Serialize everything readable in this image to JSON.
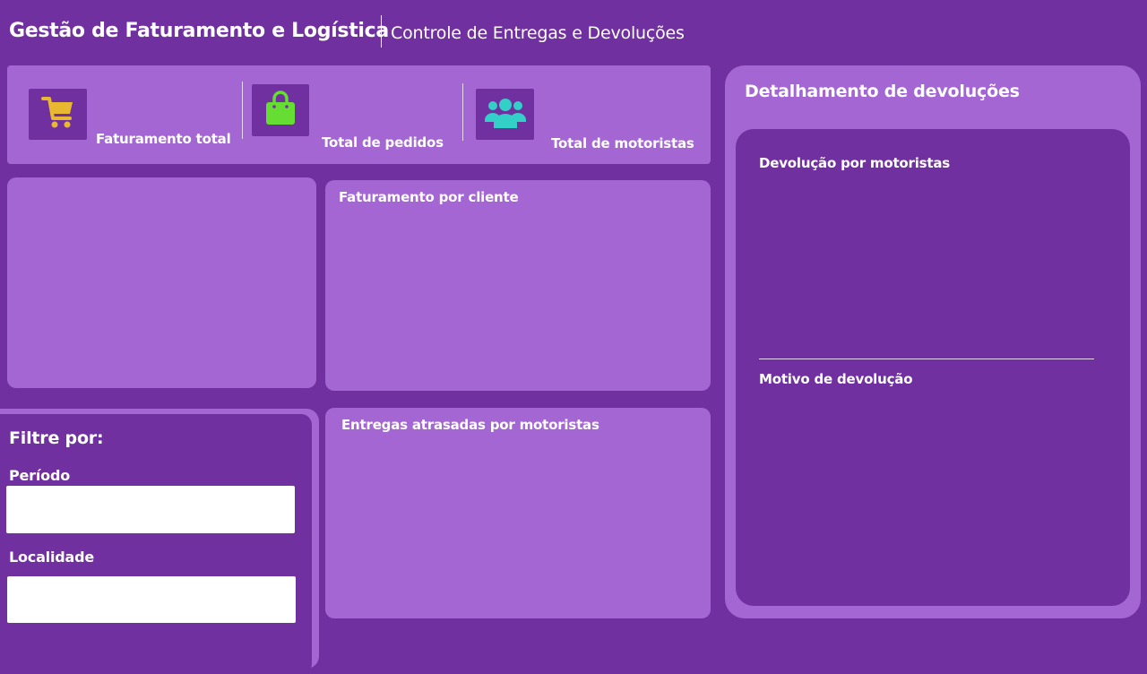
{
  "header": {
    "title": "Gestão de Faturamento e Logística",
    "subtitle": "Controle de Entregas e Devoluções"
  },
  "kpis": [
    {
      "label": "Faturamento total",
      "icon": "shopping-cart-icon",
      "icon_color": "#e8b830"
    },
    {
      "label": "Total de pedidos",
      "icon": "shopping-bag-icon",
      "icon_color": "#66dd33"
    },
    {
      "label": "Total de motoristas",
      "icon": "people-group-icon",
      "icon_color": "#33d0c8"
    }
  ],
  "panels": {
    "revenue_by_client": {
      "title": "Faturamento por cliente"
    },
    "late_deliveries": {
      "title": "Entregas atrasadas por  motoristas"
    }
  },
  "returns": {
    "title": "Detalhamento de  devoluções",
    "by_driver_title": "Devolução por motoristas",
    "reason_title": "Motivo de devolução"
  },
  "filters": {
    "title": "Filtre por:",
    "period_label": "Período",
    "period_value": "",
    "location_label": "Localidade",
    "location_value": ""
  },
  "colors": {
    "background": "#7030a0",
    "panel": "#a366d3",
    "text": "#ffffff"
  }
}
